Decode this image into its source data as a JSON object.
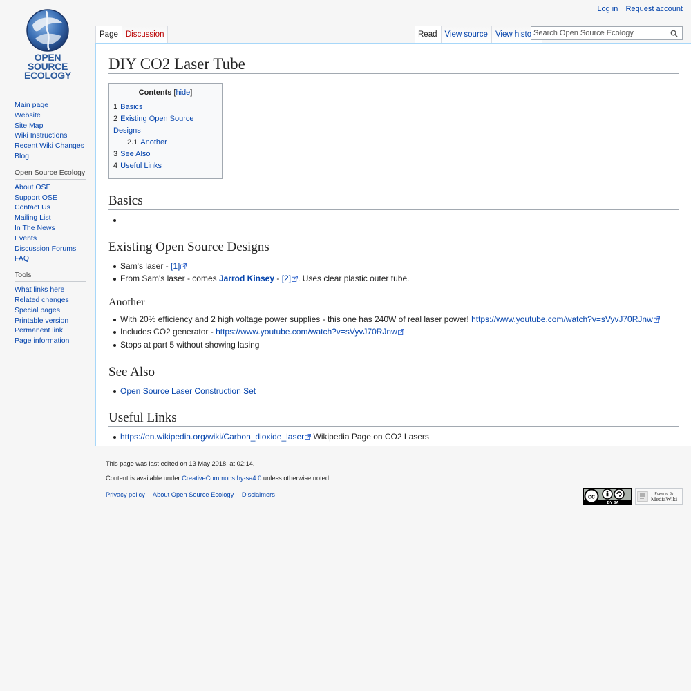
{
  "site": {
    "logo_lines": [
      "OPEN",
      "SOURCE",
      "ECOLOGY"
    ]
  },
  "personal": {
    "login": "Log in",
    "request_account": "Request account"
  },
  "tabs": {
    "page": "Page",
    "discussion": "Discussion",
    "read": "Read",
    "view_source": "View source",
    "view_history": "View history"
  },
  "search": {
    "placeholder": "Search Open Source Ecology"
  },
  "sidebar": {
    "navigation": [
      "Main page",
      "Website",
      "Site Map",
      "Wiki Instructions",
      "Recent Wiki Changes",
      "Blog"
    ],
    "ose": {
      "heading": "Open Source Ecology",
      "items": [
        "About OSE",
        "Support OSE",
        "Contact Us",
        "Mailing List",
        "In The News",
        "Events",
        "Discussion Forums",
        "FAQ"
      ]
    },
    "tools": {
      "heading": "Tools",
      "items": [
        "What links here",
        "Related changes",
        "Special pages",
        "Printable version",
        "Permanent link",
        "Page information"
      ]
    }
  },
  "article": {
    "title": "DIY CO2 Laser Tube",
    "toc": {
      "title": "Contents",
      "hide": "hide",
      "items": [
        {
          "num": "1",
          "label": "Basics"
        },
        {
          "num": "2",
          "label": "Existing Open Source Designs"
        },
        {
          "num": "2.1",
          "label": "Another"
        },
        {
          "num": "3",
          "label": "See Also"
        },
        {
          "num": "4",
          "label": "Useful Links"
        }
      ]
    },
    "basics": {
      "heading": "Basics"
    },
    "existing": {
      "heading": "Existing Open Source Designs",
      "item1_text": "Sam's laser - ",
      "item1_ref": "[1]",
      "item2_text_a": "From Sam's laser - comes ",
      "item2_bold": "Jarrod Kinsey",
      "item2_text_b": " - ",
      "item2_ref": "[2]",
      "item2_text_c": ". Uses clear plastic outer tube."
    },
    "another": {
      "heading": "Another",
      "item1_text": "With 20% efficiency and 2 high voltage power supplies - this one has 240W of real laser power! ",
      "item1_link": "https://www.youtube.com/watch?v=sVyvJ70RJnw",
      "item2_text": "Includes CO2 generator - ",
      "item2_link": "https://www.youtube.com/watch?v=sVyvJ70RJnw",
      "item3_text": "Stops at part 5 without showing lasing"
    },
    "see_also": {
      "heading": "See Also",
      "item1": "Open Source Laser Construction Set"
    },
    "useful_links": {
      "heading": "Useful Links",
      "item1_link": "https://en.wikipedia.org/wiki/Carbon_dioxide_laser",
      "item1_text": " Wikipedia Page on CO2 Lasers"
    }
  },
  "footer": {
    "last_edited": "This page was last edited on 13 May 2018, at 02:14.",
    "license_a": "Content is available under ",
    "license_link": "CreativeCommons by-sa4.0",
    "license_b": " unless otherwise noted.",
    "links": [
      "Privacy policy",
      "About Open Source Ecology",
      "Disclaimers"
    ],
    "badge_mediawiki_small": "Powered By",
    "badge_mediawiki": "MediaWiki",
    "badge_cc": "BY SA"
  },
  "colors": {
    "link": "#0645ad",
    "new_link": "#ba0000",
    "content_border": "#a7d7f9"
  }
}
